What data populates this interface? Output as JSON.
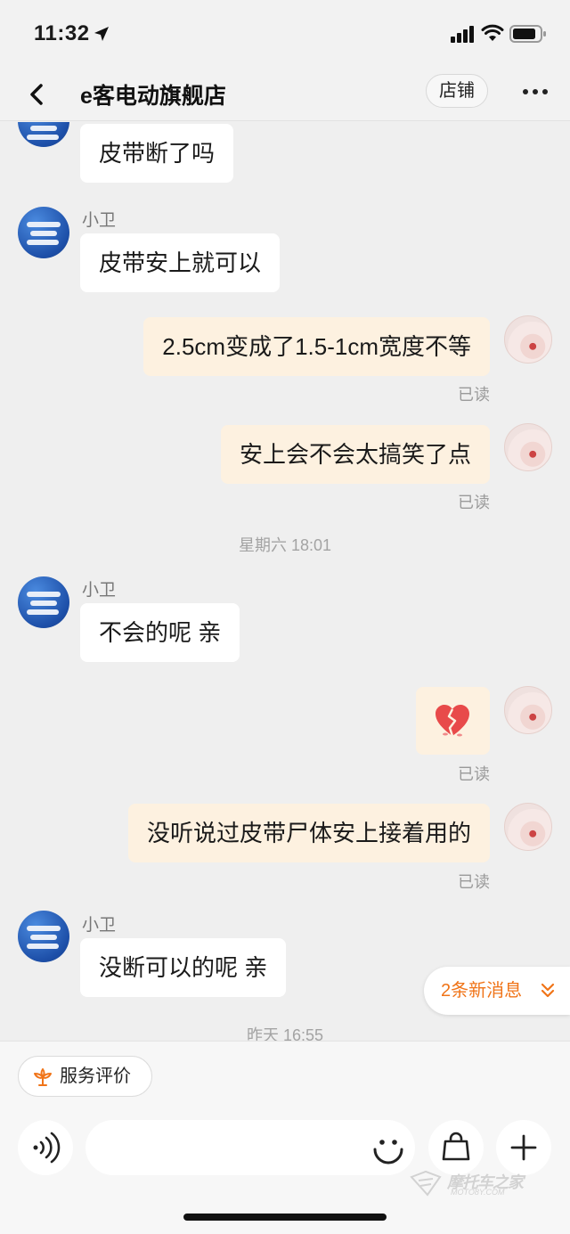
{
  "status_bar": {
    "time": "11:32"
  },
  "header": {
    "title": "e客电动旗舰店",
    "shop_button": "店铺"
  },
  "messages": [
    {
      "side": "left",
      "text": "皮带断了吗"
    },
    {
      "side": "left",
      "sender": "小卫",
      "text": "皮带安上就可以"
    },
    {
      "side": "right",
      "text": "2.5cm变成了1.5-1cm宽度不等",
      "status": "已读"
    },
    {
      "side": "right",
      "text": "安上会不会太搞笑了点",
      "status": "已读"
    },
    {
      "type": "time",
      "text": "星期六 18:01"
    },
    {
      "side": "left",
      "sender": "小卫",
      "text": "不会的呢  亲"
    },
    {
      "side": "right",
      "sticker": "broken-heart",
      "status": "已读"
    },
    {
      "side": "right",
      "text": "没听说过皮带尸体安上接着用的",
      "status": "已读"
    },
    {
      "side": "left",
      "sender": "小卫",
      "text": "没断可以的呢  亲"
    },
    {
      "type": "time",
      "text": "昨天 16:55"
    }
  ],
  "new_messages_pill": "2条新消息",
  "bottom_bar": {
    "rate_button": "服务评价",
    "input_value": "",
    "input_placeholder": ""
  },
  "watermark": {
    "text": "摩托车之家",
    "sub": "MOTO8Y.COM"
  },
  "colors": {
    "accent": "#f07418",
    "my_bubble": "#fdf1e0",
    "their_bubble": "#ffffff",
    "background": "#efefef"
  },
  "icons": [
    "location-arrow-icon",
    "signal-icon",
    "wifi-icon",
    "battery-icon",
    "back-chevron-icon",
    "more-icon",
    "broken-heart-icon",
    "chevron-double-down-icon",
    "flower-icon",
    "voice-icon",
    "emoji-icon",
    "shopping-bag-icon",
    "plus-icon"
  ]
}
